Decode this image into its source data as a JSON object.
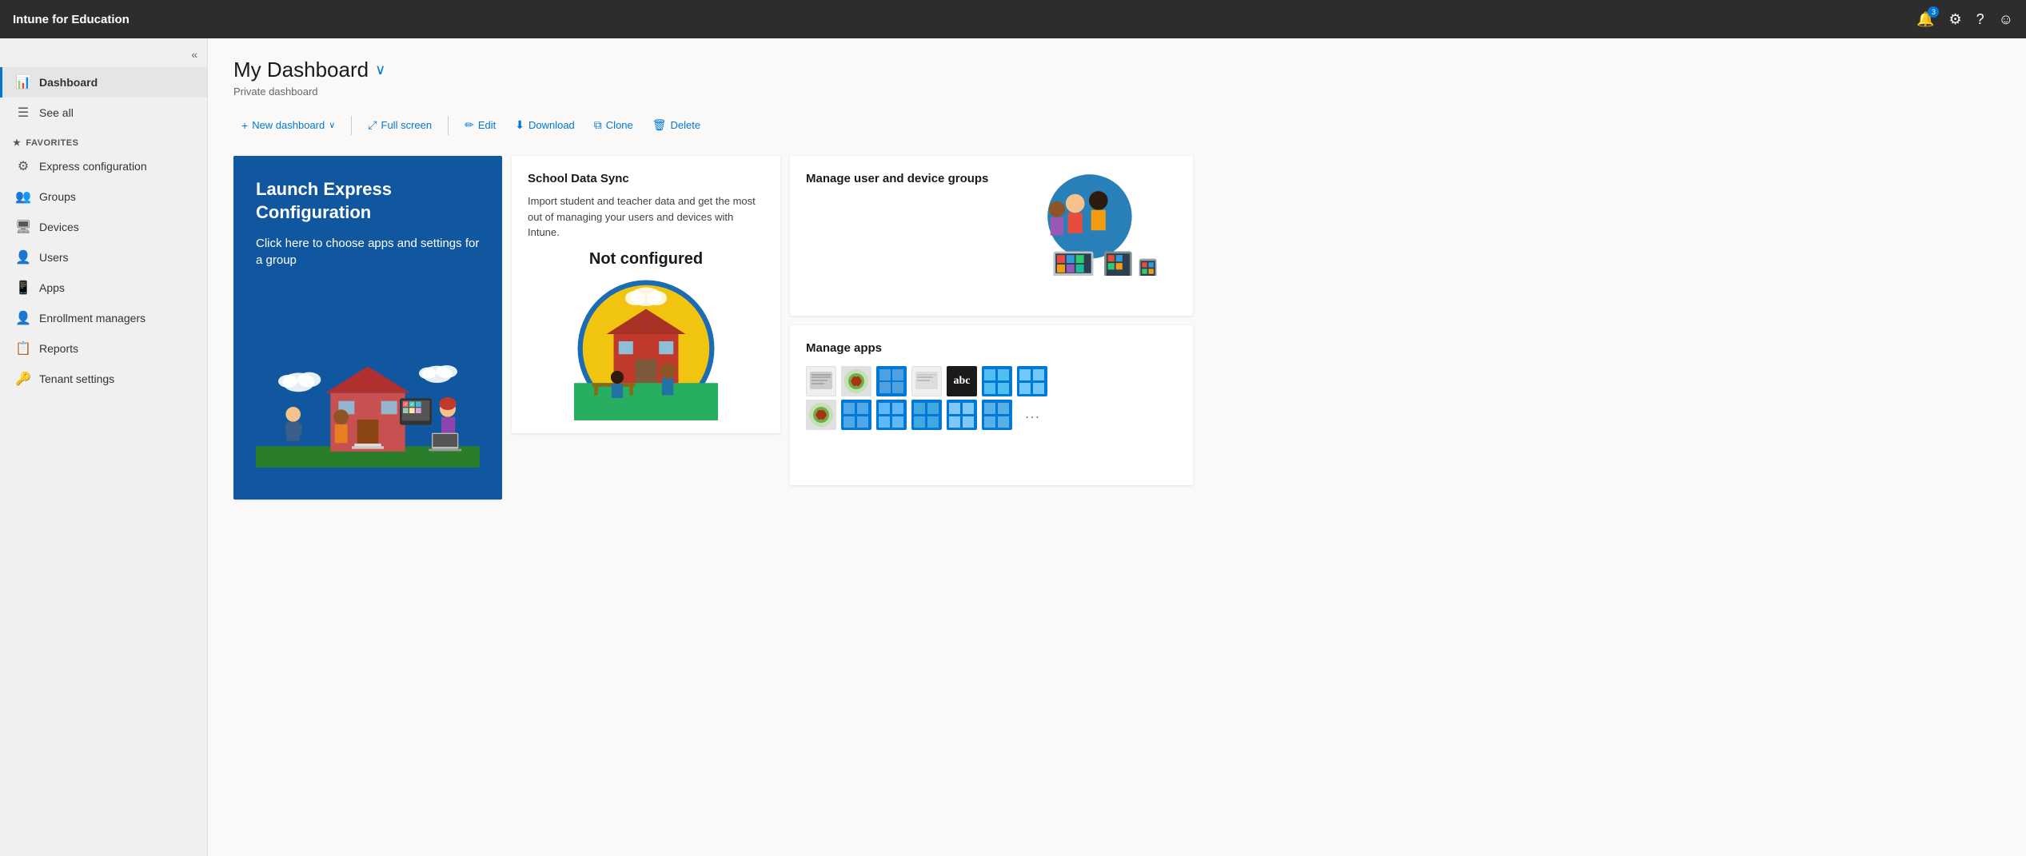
{
  "topbar": {
    "title": "Intune for Education",
    "notification_count": "3",
    "icons": [
      "bell",
      "gear",
      "help",
      "smiley"
    ]
  },
  "sidebar": {
    "collapse_tooltip": "Collapse",
    "items": [
      {
        "id": "dashboard",
        "label": "Dashboard",
        "icon": "📊",
        "active": true
      },
      {
        "id": "see-all",
        "label": "See all",
        "icon": "☰",
        "active": false
      }
    ],
    "section_favorites": "FAVORITES",
    "favorites": [
      {
        "id": "express-config",
        "label": "Express configuration",
        "icon": "⚙"
      },
      {
        "id": "groups",
        "label": "Groups",
        "icon": "👥"
      },
      {
        "id": "devices",
        "label": "Devices",
        "icon": "🖥"
      },
      {
        "id": "users",
        "label": "Users",
        "icon": "👤"
      },
      {
        "id": "apps",
        "label": "Apps",
        "icon": "📱"
      },
      {
        "id": "enrollment-managers",
        "label": "Enrollment managers",
        "icon": "👤"
      },
      {
        "id": "reports",
        "label": "Reports",
        "icon": "📋"
      },
      {
        "id": "tenant-settings",
        "label": "Tenant settings",
        "icon": "🔑"
      }
    ]
  },
  "main": {
    "page_title": "My Dashboard",
    "page_subtitle": "Private dashboard",
    "toolbar": {
      "new_dashboard": "New dashboard",
      "full_screen": "Full screen",
      "edit": "Edit",
      "download": "Download",
      "clone": "Clone",
      "delete": "Delete"
    },
    "cards": {
      "launch_express": {
        "title": "Launch Express Configuration",
        "description": "Click here to choose apps and settings for a group"
      },
      "school_data_sync": {
        "title": "School Data Sync",
        "description": "Import student and teacher data and get the most out of managing your users and devices with Intune.",
        "status": "Not configured"
      },
      "manage_groups": {
        "title": "Manage user and device groups"
      },
      "manage_apps": {
        "title": "Manage apps",
        "dots": "..."
      }
    }
  }
}
